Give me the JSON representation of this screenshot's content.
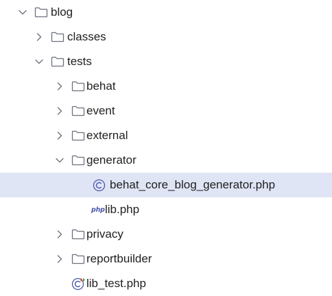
{
  "tree": {
    "root": {
      "label": "blog",
      "expanded": true,
      "icon": "folder-icon"
    },
    "classes": {
      "label": "classes",
      "expanded": false,
      "icon": "folder-icon"
    },
    "tests": {
      "label": "tests",
      "expanded": true,
      "icon": "folder-icon"
    },
    "behat": {
      "label": "behat",
      "expanded": false,
      "icon": "folder-icon"
    },
    "event": {
      "label": "event",
      "expanded": false,
      "icon": "folder-icon"
    },
    "external": {
      "label": "external",
      "expanded": false,
      "icon": "folder-icon"
    },
    "generator": {
      "label": "generator",
      "expanded": true,
      "icon": "folder-icon"
    },
    "generator_file": {
      "label": "behat_core_blog_generator.php",
      "icon": "php-class-icon",
      "selected": true
    },
    "lib_file": {
      "label": "lib.php",
      "icon": "php-file-icon",
      "badge": "php"
    },
    "privacy": {
      "label": "privacy",
      "expanded": false,
      "icon": "folder-icon"
    },
    "reportbuilder": {
      "label": "reportbuilder",
      "expanded": false,
      "icon": "folder-icon"
    },
    "lib_test_file": {
      "label": "lib_test.php",
      "icon": "php-test-class-icon"
    }
  },
  "colors": {
    "selection": "#dfe5f5",
    "folder_stroke": "#6c707e",
    "class_icon": "#4b57a8",
    "test_badge_red": "#e5493a",
    "test_badge_green": "#3fa34d"
  }
}
